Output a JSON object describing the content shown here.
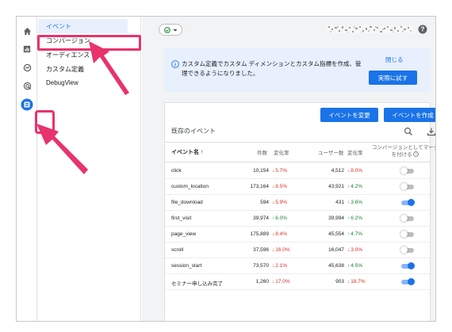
{
  "colors": {
    "accent": "#1a73e8",
    "highlight": "#e8336d",
    "down": "#d93025",
    "up": "#188038"
  },
  "rail": {
    "icons": [
      "home-icon",
      "reports-icon",
      "explore-icon",
      "advertising-icon",
      "configure-icon"
    ]
  },
  "nav": {
    "items": [
      {
        "label": "イベント",
        "active": true
      },
      {
        "label": "コンバージョン"
      },
      {
        "label": "オーディエンス"
      },
      {
        "label": "カスタム定義"
      },
      {
        "label": "DebugView"
      }
    ]
  },
  "notice": {
    "text": "カスタム定義でカスタム ディメンションとカスタム指標を作成、管理できるようになりました。",
    "close_label": "閉じる",
    "try_label": "実際に試す"
  },
  "card": {
    "modify_button": "イベントを変更",
    "create_button": "イベントを作成",
    "title": "既存のイベント",
    "headers": {
      "event_name": "イベント名 ↑",
      "count": "件数",
      "count_change": "変化率",
      "users": "ユーザー数",
      "users_change": "変化率",
      "conversion": "コンバージョンとしてマークを付ける"
    },
    "rows": [
      {
        "name": "click",
        "count": "10,154",
        "count_change": "5.7%",
        "count_dir": "down",
        "users": "4,512",
        "users_change": "8.0%",
        "users_dir": "down",
        "conversion": false
      },
      {
        "name": "custom_location",
        "count": "173,164",
        "count_change": "8.5%",
        "count_dir": "down",
        "users": "43,921",
        "users_change": "4.2%",
        "users_dir": "up",
        "conversion": false
      },
      {
        "name": "file_download",
        "count": "594",
        "count_change": "5.9%",
        "count_dir": "down",
        "users": "431",
        "users_change": "3.6%",
        "users_dir": "up",
        "conversion": true
      },
      {
        "name": "first_visit",
        "count": "39,974",
        "count_change": "6.0%",
        "count_dir": "up",
        "users": "39,994",
        "users_change": "6.2%",
        "users_dir": "up",
        "conversion": false
      },
      {
        "name": "page_view",
        "count": "175,889",
        "count_change": "8.4%",
        "count_dir": "down",
        "users": "45,554",
        "users_change": "4.7%",
        "users_dir": "up",
        "conversion": false
      },
      {
        "name": "scroll",
        "count": "37,596",
        "count_change": "16.0%",
        "count_dir": "down",
        "users": "16,047",
        "users_change": "3.0%",
        "users_dir": "down",
        "conversion": false
      },
      {
        "name": "session_start",
        "count": "73,570",
        "count_change": "2.1%",
        "count_dir": "down",
        "users": "45,638",
        "users_change": "4.5%",
        "users_dir": "up",
        "conversion": true
      },
      {
        "name": "セミナー申し込み完了",
        "count": "1,260",
        "count_change": "17.0%",
        "count_dir": "down",
        "users": "903",
        "users_change": "18.7%",
        "users_dir": "down",
        "conversion": true
      }
    ]
  }
}
